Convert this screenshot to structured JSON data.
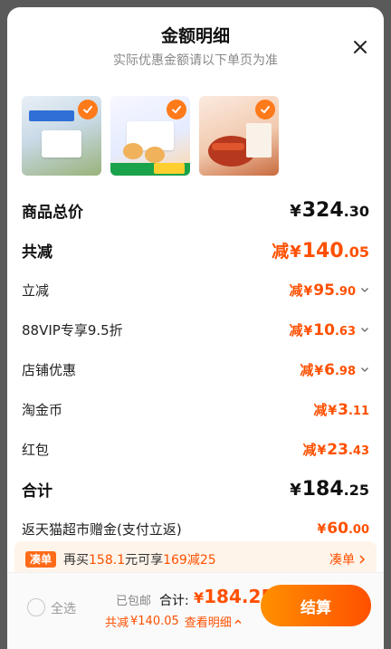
{
  "header": {
    "title": "金额明细",
    "subtitle": "实际优惠金额请以下单页为准"
  },
  "rows": [
    {
      "label": "商品总价",
      "prefix": "",
      "yuan": "¥",
      "int": "324",
      "dec": ".30",
      "color": "#111111"
    },
    {
      "label": "共减",
      "prefix": "减",
      "yuan": "¥",
      "int": "140",
      "dec": ".05",
      "color": "#ff5000"
    },
    {
      "label": "立减",
      "prefix": "减",
      "yuan": "¥",
      "int": "95",
      "dec": ".90",
      "color": "#ff5000"
    },
    {
      "label": "88VIP专享9.5折",
      "prefix": "减",
      "yuan": "¥",
      "int": "10",
      "dec": ".63",
      "color": "#ff5000"
    },
    {
      "label": "店铺优惠",
      "prefix": "减",
      "yuan": "¥",
      "int": "6",
      "dec": ".98",
      "color": "#ff5000"
    },
    {
      "label": "淘金币",
      "prefix": "减",
      "yuan": "¥",
      "int": "3",
      "dec": ".11",
      "color": "#ff5000"
    },
    {
      "label": "红包",
      "prefix": "减",
      "yuan": "¥",
      "int": "23",
      "dec": ".43",
      "color": "#ff5000"
    },
    {
      "label": "合计",
      "prefix": "",
      "yuan": "¥",
      "int": "184",
      "dec": ".25",
      "color": "#111111"
    },
    {
      "label": "返天猫超市赠金(支付立返)",
      "prefix": "",
      "yuan": "¥",
      "int": "60",
      "dec": ".00",
      "color": "#ff5000"
    }
  ],
  "products": [
    {
      "icon": "milk-product-image",
      "selected": true
    },
    {
      "icon": "bread-product-image",
      "selected": true
    },
    {
      "icon": "chicken-feet-product-image",
      "selected": true
    }
  ],
  "promo": {
    "tag": "凑单",
    "text_pre": "再买",
    "amount": "158.1",
    "text_mid": "元可享",
    "deal": "169减25",
    "link": "凑单"
  },
  "footer": {
    "select_all": "全选",
    "shipping": "已包邮",
    "total_label": "合计:",
    "total_yuan": "¥",
    "total_value": "184.25",
    "discount_label": "共减",
    "discount_value": "¥140.05",
    "view_detail": "查看明细",
    "checkout": "结算"
  },
  "colors": {
    "accent": "#ff5000",
    "checkout_start": "#ff9000",
    "checkout_end": "#ff5000"
  }
}
